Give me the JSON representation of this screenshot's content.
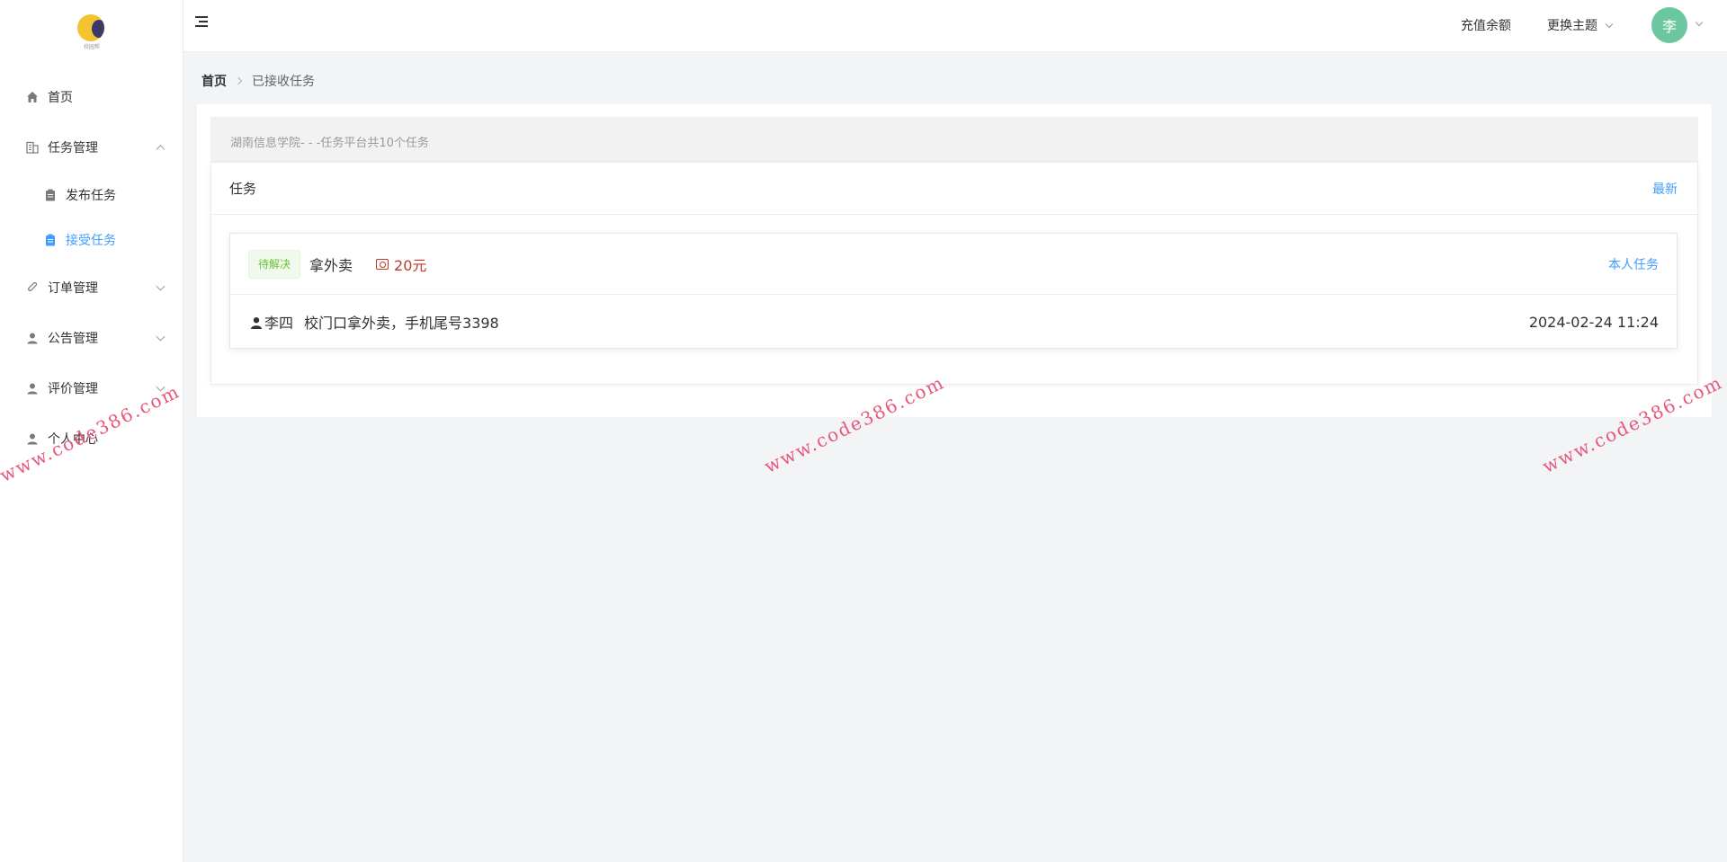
{
  "sidebar": {
    "logo_caption": "校园帮",
    "items": [
      {
        "label": "首页",
        "icon": "home-icon"
      },
      {
        "label": "任务管理",
        "icon": "building-icon",
        "expanded": true,
        "children": [
          {
            "label": "发布任务",
            "icon": "clipboard-icon"
          },
          {
            "label": "接受任务",
            "icon": "clipboard-icon",
            "active": true
          }
        ]
      },
      {
        "label": "订单管理",
        "icon": "paperclip-icon"
      },
      {
        "label": "公告管理",
        "icon": "user-icon"
      },
      {
        "label": "评价管理",
        "icon": "user-icon"
      },
      {
        "label": "个人中心",
        "icon": "user-icon"
      }
    ]
  },
  "header": {
    "recharge": "充值余额",
    "theme": "更换主题",
    "avatar_text": "李"
  },
  "breadcrumb": {
    "home": "首页",
    "current": "已接收任务"
  },
  "notice": "湖南信息学院- - -任务平台共10个任务",
  "task_panel": {
    "title": "任务",
    "latest": "最新",
    "items": [
      {
        "status": "待解决",
        "name": "拿外卖",
        "price": "20元",
        "own_label": "本人任务",
        "user": "李四",
        "description": "校门口拿外卖，手机尾号3398",
        "time": "2024-02-24 11:24"
      }
    ]
  },
  "watermark": "www.code386.com",
  "colors": {
    "accent": "#409eff",
    "status_green": "#67c23a",
    "price_red": "#c0392b",
    "avatar_bg": "#6cc7a0",
    "watermark": "#e8577a"
  }
}
